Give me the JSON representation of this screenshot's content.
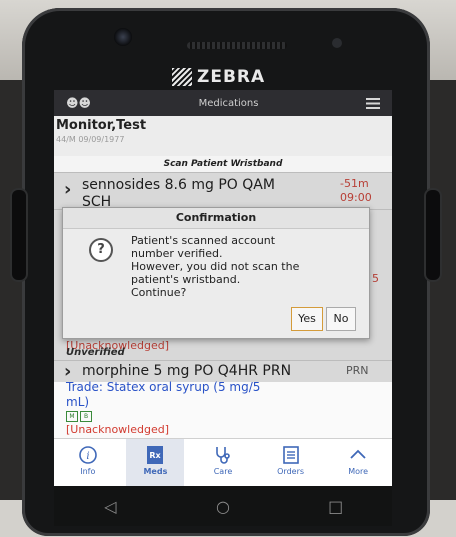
{
  "device": {
    "brand": "ZEBRA"
  },
  "appbar": {
    "title": "Medications"
  },
  "patient": {
    "name": "Monitor,Test",
    "info": "44/M 09/09/1977"
  },
  "scan_hint": "Scan Patient Wristband",
  "meds": [
    {
      "title_line1": "sennosides 8.6 mg PO QAM",
      "title_line2": "SCH",
      "time_line1": "-51m",
      "time_line2": "09:00"
    },
    {
      "partial_time": "5",
      "unacknowledged": "[Unacknowledged]",
      "unverified": "Unverified"
    },
    {
      "title": "morphine 5 mg PO Q4HR PRN",
      "prn": "PRN",
      "trade_line1": "Trade: Statex oral syrup (5 mg/5",
      "trade_line2": "mL)",
      "unacknowledged": "[Unacknowledged]",
      "badges": [
        "M",
        "B"
      ]
    }
  ],
  "dialog": {
    "title": "Confirmation",
    "lines": [
      "Patient's scanned account",
      "number verified.",
      "However, you did not scan the",
      "patient's wristband.",
      "Continue?"
    ],
    "yes": "Yes",
    "no": "No",
    "icon": "question-icon"
  },
  "nav": [
    {
      "label": "Info",
      "icon": "info-icon"
    },
    {
      "label": "Meds",
      "icon": "rx-icon",
      "active": true
    },
    {
      "label": "Care",
      "icon": "stethoscope-icon"
    },
    {
      "label": "Orders",
      "icon": "clipboard-icon"
    },
    {
      "label": "More",
      "icon": "chevron-up-icon"
    }
  ],
  "system_nav": [
    "back-icon",
    "home-icon",
    "recents-icon"
  ]
}
